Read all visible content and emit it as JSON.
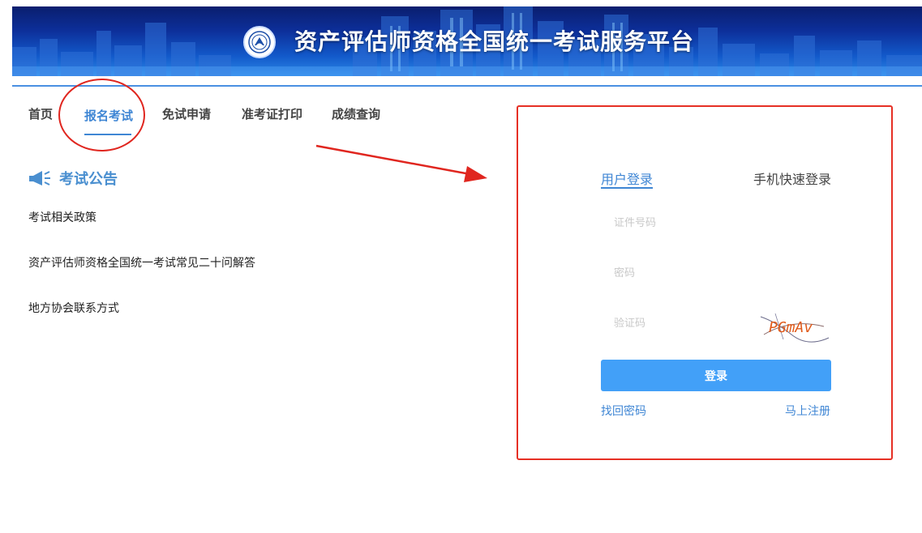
{
  "header": {
    "title": "资产评估师资格全国统一考试服务平台",
    "logo_icon": "association-logo-icon"
  },
  "nav": {
    "items": [
      {
        "label": "首页",
        "active": false
      },
      {
        "label": "报名考试",
        "active": true
      },
      {
        "label": "免试申请",
        "active": false
      },
      {
        "label": "准考证打印",
        "active": false
      },
      {
        "label": "成绩查询",
        "active": false
      }
    ]
  },
  "notice": {
    "title": "考试公告",
    "icon": "megaphone-icon",
    "links": [
      "考试相关政策",
      "资产评估师资格全国统一考试常见二十问解答",
      "地方协会联系方式"
    ]
  },
  "login": {
    "tabs": {
      "user": "用户登录",
      "phone": "手机快速登录"
    },
    "username_placeholder": "证件号码",
    "password_placeholder": "密码",
    "captcha_placeholder": "验证码",
    "captcha_text": "PGmAv",
    "submit_label": "登录",
    "forgot_label": "找回密码",
    "register_label": "马上注册"
  },
  "colors": {
    "accent": "#3f86d4",
    "button": "#42a0f8",
    "annotation": "#e0261f",
    "captcha": "#e05a1a"
  }
}
